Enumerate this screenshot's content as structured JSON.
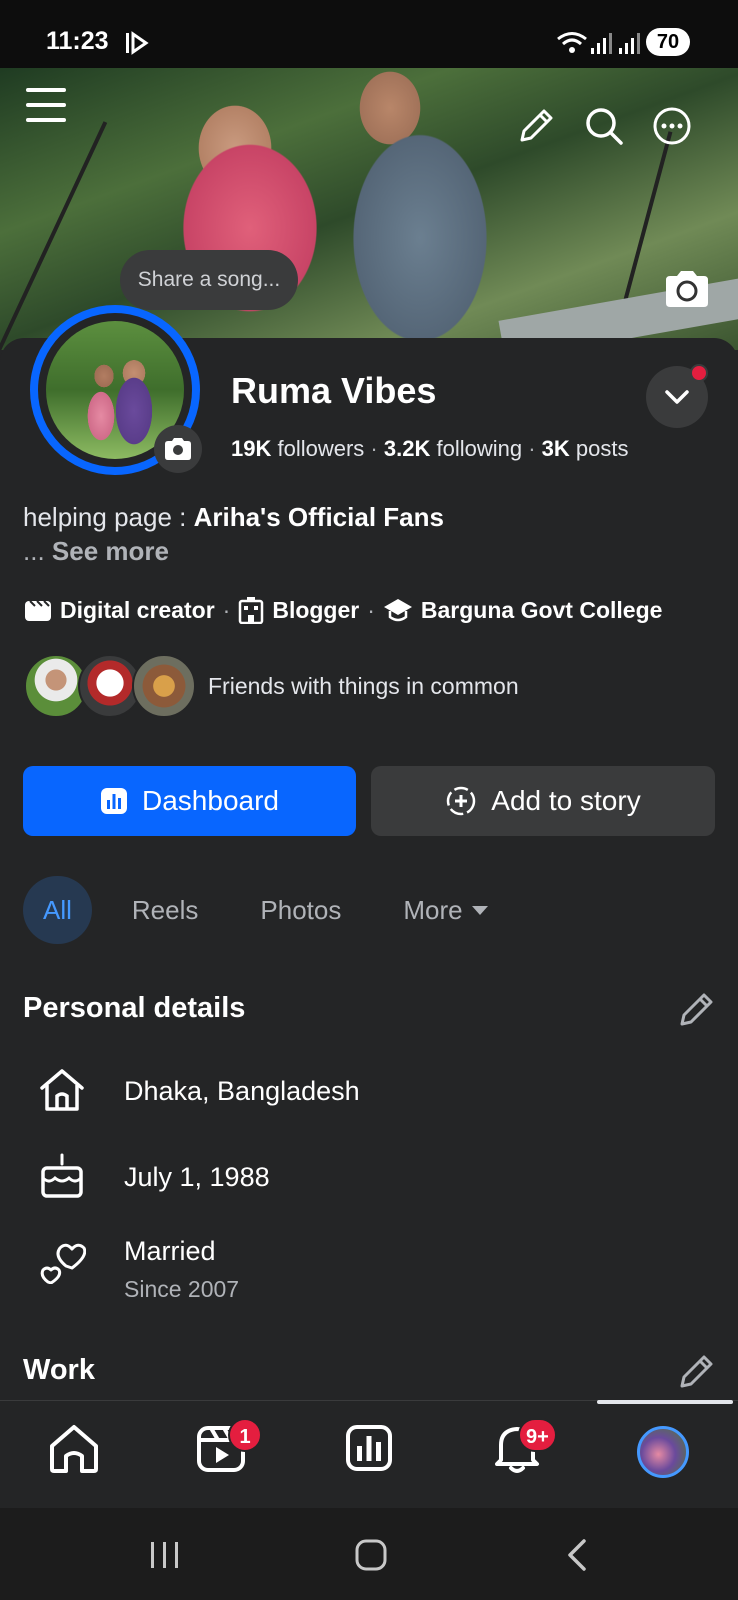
{
  "status_bar": {
    "time": "11:23",
    "battery": "70"
  },
  "cover": {
    "share_song": "Share a song..."
  },
  "profile": {
    "name": "Ruma Vibes",
    "followers_count": "19K",
    "followers_label": "followers",
    "following_count": "3.2K",
    "following_label": "following",
    "posts_count": "3K",
    "posts_label": "posts",
    "bio_prefix": "helping page : ",
    "bio_link": "Ariha's Official Fans",
    "see_more_prefix": "... ",
    "see_more": "See more"
  },
  "tags": [
    {
      "label": "Digital creator",
      "icon": "clapperboard-icon"
    },
    {
      "label": "Blogger",
      "icon": "building-icon"
    },
    {
      "label": "Barguna Govt College",
      "icon": "graduation-cap-icon"
    }
  ],
  "friends": {
    "text": "Friends with things in common"
  },
  "buttons": {
    "dashboard": "Dashboard",
    "add_story": "Add to story"
  },
  "tabs": [
    {
      "label": "All",
      "active": true
    },
    {
      "label": "Reels"
    },
    {
      "label": "Photos"
    },
    {
      "label": "More"
    }
  ],
  "personal_details": {
    "title": "Personal details",
    "items": [
      {
        "icon": "home-icon",
        "text": "Dhaka, Bangladesh"
      },
      {
        "icon": "cake-icon",
        "text": "July 1, 1988"
      },
      {
        "icon": "hearts-icon",
        "text": "Married",
        "sub": "Since 2007"
      }
    ]
  },
  "work": {
    "title": "Work"
  },
  "bottom_nav": {
    "items": [
      {
        "icon": "home-icon"
      },
      {
        "icon": "reels-icon",
        "badge": "1"
      },
      {
        "icon": "dashboard-icon"
      },
      {
        "icon": "bell-icon",
        "badge": "9+"
      },
      {
        "icon": "profile-avatar"
      }
    ]
  },
  "colors": {
    "accent": "#0866ff",
    "background": "#242526",
    "chip": "#3a3b3c",
    "badge": "#e41e3f"
  }
}
